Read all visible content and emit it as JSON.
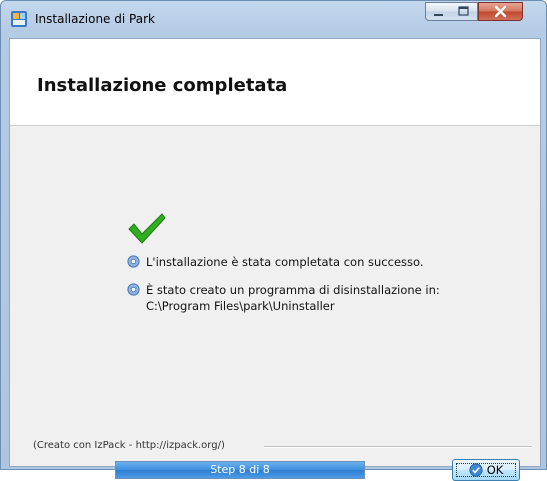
{
  "window": {
    "title": "Installazione di  Park",
    "icon": "installer-icon"
  },
  "controls": {
    "minimize_icon": "minimize-icon",
    "maximize_icon": "maximize-icon",
    "close_icon": "close-icon"
  },
  "header": {
    "title": "Installazione completata"
  },
  "content": {
    "status_icon": "checkmark-icon",
    "messages": [
      "L'installazione è stata completata con successo.",
      "È stato creato un programma di disinstallazione in:"
    ],
    "uninstaller_path": "C:\\Program Files\\park\\Uninstaller"
  },
  "footer": {
    "creator": "(Creato con IzPack - http://izpack.org/)",
    "progress_label": "Step 8 di 8",
    "progress_value": 1.0,
    "ok_label": "OK"
  },
  "colors": {
    "progress": "#3d8fe0",
    "checkmark": "#2fae1f",
    "title_bar": "#c4d8ee",
    "close_button": "#c0472d"
  }
}
